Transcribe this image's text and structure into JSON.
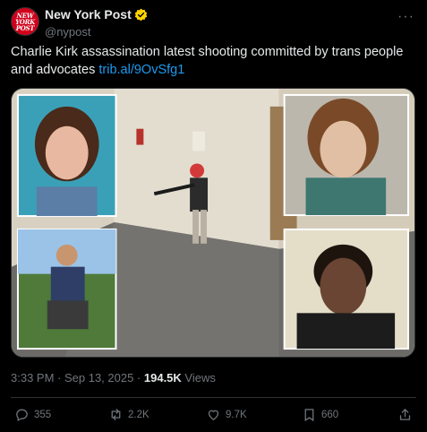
{
  "account": {
    "display_name": "New York Post",
    "handle": "@nypost",
    "avatar_text": [
      "NEW",
      "YORK",
      "POST"
    ]
  },
  "tweet": {
    "text": "Charlie Kirk assassination latest shooting committed by trans people and advocates ",
    "link": "trib.al/9OvSfg1"
  },
  "media": {
    "description_icons": [
      "photo-collage"
    ]
  },
  "meta": {
    "timestamp": "3:33 PM · Sep 13, 2025 · ",
    "views_count": "194.5K",
    "views_label": " Views"
  },
  "actions": {
    "replies": "355",
    "reposts": "2.2K",
    "likes": "9.7K",
    "bookmarks": "660"
  },
  "colors": {
    "background": "#000000",
    "text": "#e7e9ea",
    "muted": "#71767b",
    "link": "#1d9bf0",
    "verified": "#ffd400",
    "brand": "#d0021b"
  }
}
